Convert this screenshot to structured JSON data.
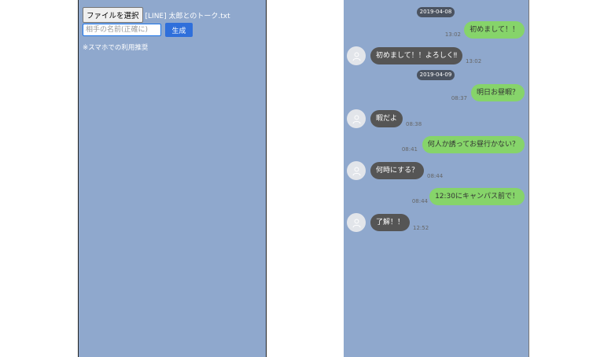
{
  "form": {
    "file_button_label": "ファイルを選択",
    "file_name": "[LINE] 太郎とのトーク.txt",
    "name_placeholder": "相手の名前(正確に)",
    "generate_label": "生成",
    "note": "※スマホでの利用推奨"
  },
  "chat": {
    "dates": [
      "2019-04-08",
      "2019-04-09"
    ],
    "messages": [
      {
        "from": "me",
        "text": "初めまして！！",
        "time": "13:02"
      },
      {
        "from": "other",
        "text": "初めまして！！よろしく‼",
        "time": "13:02"
      },
      {
        "from": "me",
        "text": "明日お昼暇？",
        "time": "08:37"
      },
      {
        "from": "other",
        "text": "暇だよ",
        "time": "08:38"
      },
      {
        "from": "me",
        "text": "何人か誘ってお昼行かない？",
        "time": "08:41"
      },
      {
        "from": "other",
        "text": "何時にする？",
        "time": "08:44"
      },
      {
        "from": "me",
        "text": "12:30にキャンパス前で！",
        "time": "08:44"
      },
      {
        "from": "other",
        "text": "了解！！",
        "time": "12:52"
      }
    ]
  },
  "colors": {
    "panel_background": "#8fa8cd",
    "my_bubble": "#86d46a",
    "other_bubble": "#555555",
    "date_pill": "#4b5360",
    "generate_button": "#2f6fdb"
  },
  "icons": {
    "avatar": "user-icon"
  }
}
